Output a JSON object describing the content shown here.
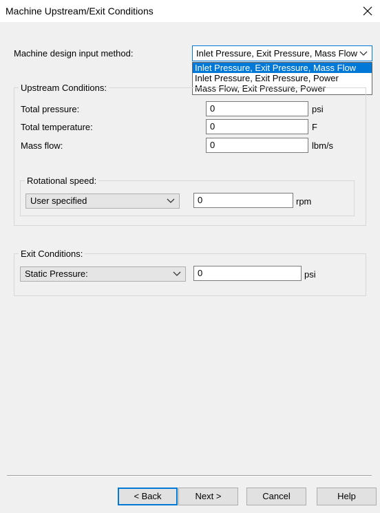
{
  "window": {
    "title": "Machine Upstream/Exit Conditions",
    "close_glyph": "✕"
  },
  "design_input": {
    "label": "Machine design input method:",
    "selected": "Inlet Pressure, Exit Pressure, Mass Flow",
    "options": [
      "Inlet Pressure, Exit Pressure, Mass Flow",
      "Inlet Pressure, Exit Pressure, Power",
      "Mass Flow, Exit Pressure, Power"
    ]
  },
  "upstream": {
    "title": "Upstream Conditions:",
    "total_pressure": {
      "label": "Total pressure:",
      "value": "0",
      "unit": "psi"
    },
    "total_temperature": {
      "label": "Total temperature:",
      "value": "0",
      "unit": "F"
    },
    "mass_flow": {
      "label": "Mass flow:",
      "value": "0",
      "unit": "lbm/s"
    },
    "rotational_speed": {
      "title": "Rotational speed:",
      "mode": "User specified",
      "value": "0",
      "unit": "rpm"
    }
  },
  "exit": {
    "title": "Exit Conditions:",
    "mode": "Static Pressure:",
    "value": "0",
    "unit": "psi"
  },
  "buttons": {
    "back": "< Back",
    "next": "Next >",
    "cancel": "Cancel",
    "help": "Help"
  },
  "colors": {
    "accent": "#0078d7",
    "dialog_bg": "#f0f0f0"
  }
}
